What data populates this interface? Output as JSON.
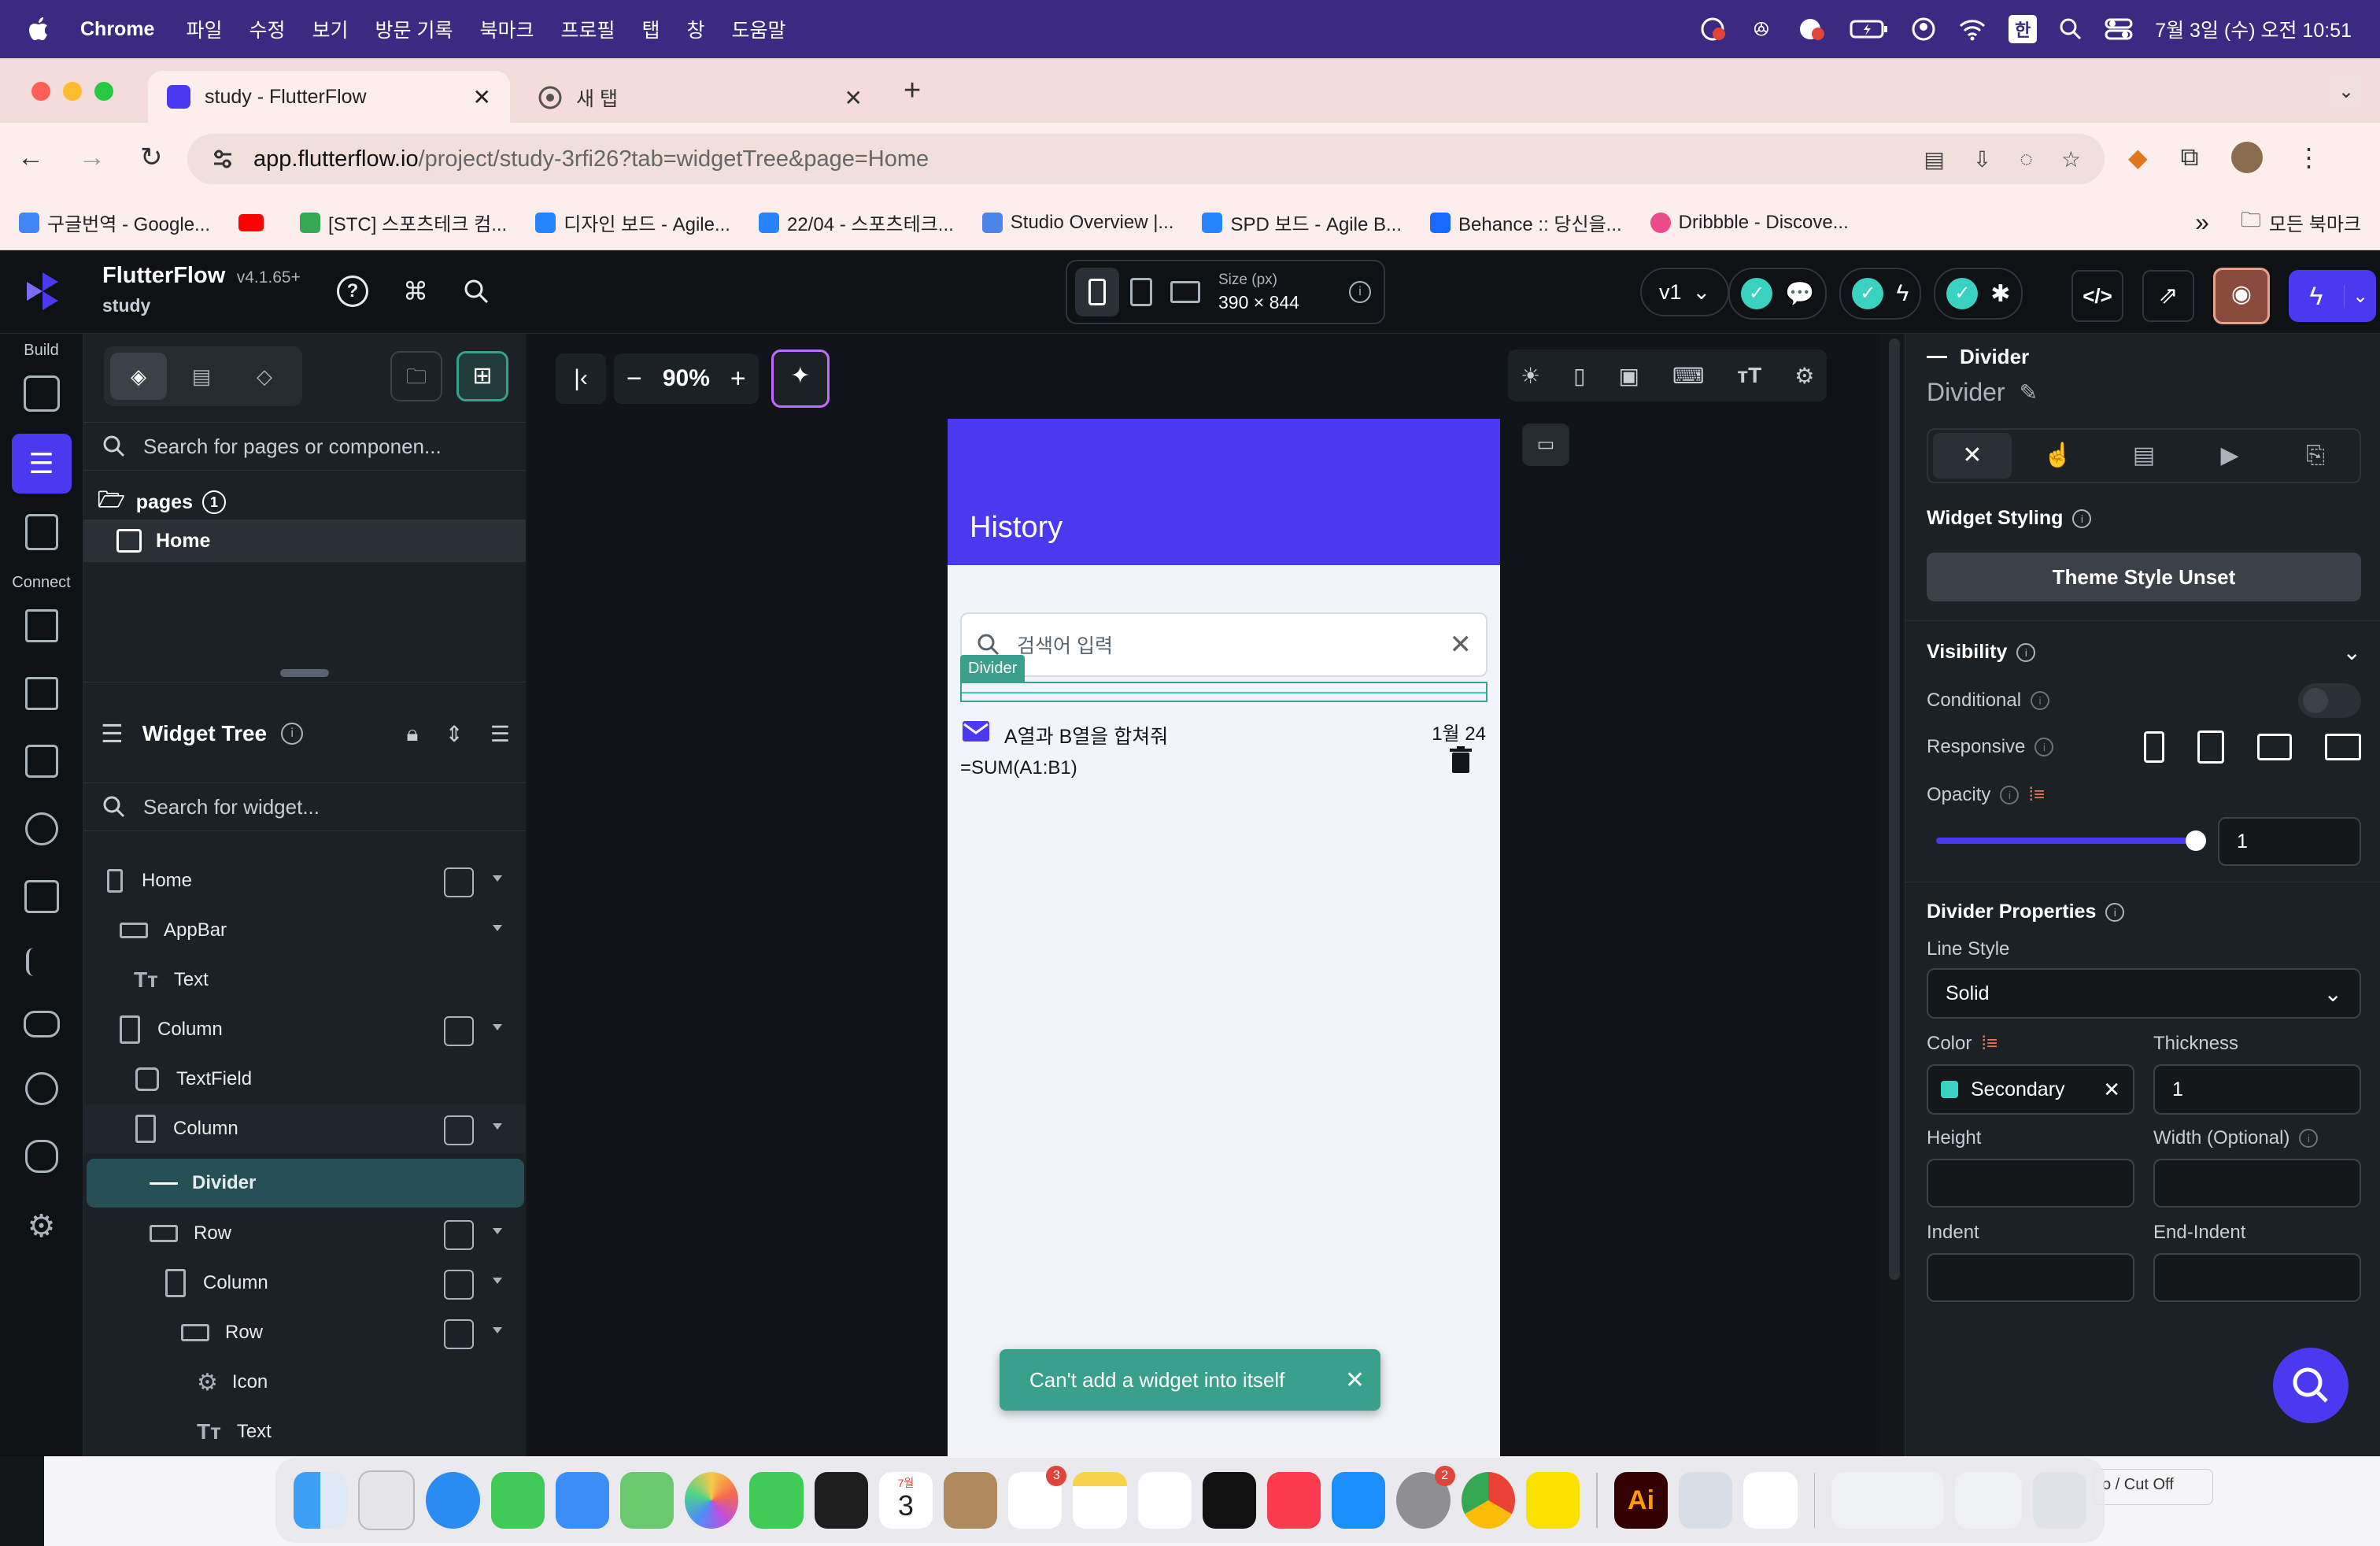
{
  "menubar": {
    "app": "Chrome",
    "items": [
      "파일",
      "수정",
      "보기",
      "방문 기록",
      "북마크",
      "프로필",
      "탭",
      "창",
      "도움말"
    ],
    "input_source": "한",
    "clock": "7월 3일 (수) 오전 10:51"
  },
  "browser": {
    "tabs": [
      {
        "title": "study - FlutterFlow"
      },
      {
        "title": "새 탭"
      }
    ],
    "url_host": "app.flutterflow.io",
    "url_path": "/project/study-3rfi26?tab=widgetTree&page=Home",
    "bookmarks": [
      {
        "label": "구글번역 - Google...",
        "color": "#4285f4"
      },
      {
        "label": "",
        "color": "#ff0000"
      },
      {
        "label": "[STC] 스포츠테크 컴...",
        "color": "#34a853"
      },
      {
        "label": "디자인 보드 - Agile...",
        "color": "#2684ff"
      },
      {
        "label": "22/04 - 스포츠테크...",
        "color": "#2684ff"
      },
      {
        "label": "Studio Overview |...",
        "color": "#4a86e8"
      },
      {
        "label": "SPD 보드 - Agile B...",
        "color": "#2684ff"
      },
      {
        "label": "Behance :: 당신을...",
        "color": "#1769ff"
      },
      {
        "label": "Dribbble - Discove...",
        "color": "#ea4c89"
      }
    ],
    "more": "»",
    "all_bookmarks": "모든 북마크"
  },
  "ff": {
    "brand": "FlutterFlow",
    "version": "v4.1.65+",
    "project": "study",
    "size_label": "Size (px)",
    "size_value": "390 × 844",
    "branch": "v1",
    "rail": {
      "build": "Build",
      "connect": "Connect"
    },
    "search_pages_placeholder": "Search for pages or componen...",
    "pages_label": "pages",
    "pages_count": "1",
    "page_home": "Home",
    "widget_tree_title": "Widget Tree",
    "search_widget_placeholder": "Search for widget...",
    "tree": [
      {
        "label": "Home"
      },
      {
        "label": "AppBar"
      },
      {
        "label": "Text"
      },
      {
        "label": "Column"
      },
      {
        "label": "TextField"
      },
      {
        "label": "Column"
      },
      {
        "label": "Divider"
      },
      {
        "label": "Row"
      },
      {
        "label": "Column"
      },
      {
        "label": "Row"
      },
      {
        "label": "Icon"
      },
      {
        "label": "Text"
      }
    ],
    "zoom": "90%",
    "accent": "#4b39ef",
    "selection_color": "#39a08c"
  },
  "phone": {
    "appbar_title": "History",
    "search_placeholder": "검색어 입력",
    "divider_tag": "Divider",
    "item_title": "A열과 B열을 합쳐줘",
    "item_date": "1월 24",
    "item_formula": "=SUM(A1:B1)",
    "toast": "Can't add a widget into itself"
  },
  "props": {
    "widget_type": "Divider",
    "widget_name": "Divider",
    "widget_styling": "Widget Styling",
    "theme_style": "Theme Style Unset",
    "visibility": "Visibility",
    "conditional": "Conditional",
    "responsive": "Responsive",
    "opacity": "Opacity",
    "opacity_value": "1",
    "opacity_level": 1,
    "divider_properties": "Divider Properties",
    "line_style_label": "Line Style",
    "line_style_value": "Solid",
    "color_label": "Color",
    "color_value": "Secondary",
    "color_swatch": "#39d2c0",
    "thickness_label": "Thickness",
    "thickness_value": "1",
    "height_label": "Height",
    "width_label": "Width (Optional)",
    "indent_label": "Indent",
    "end_indent_label": "End-Indent"
  },
  "dock": {
    "badge_reminders": "3",
    "badge_settings": "2",
    "calendar_month": "7월",
    "calendar_day": "3",
    "partial_text": "o / Cut Off"
  }
}
